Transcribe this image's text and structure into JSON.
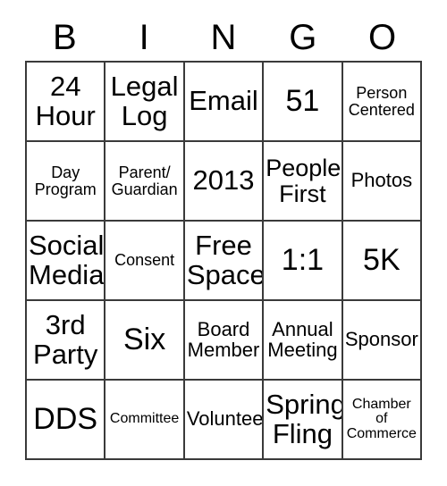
{
  "card": {
    "title_letters": [
      "B",
      "I",
      "N",
      "G",
      "O"
    ],
    "columns": 5,
    "rows": 5,
    "grid": [
      [
        {
          "text": "24\nHour",
          "size": "fs-xl"
        },
        {
          "text": "Legal\nLog",
          "size": "fs-xl"
        },
        {
          "text": "Email",
          "size": "fs-xl"
        },
        {
          "text": "51",
          "size": "fs-xxl"
        },
        {
          "text": "Person\nCentered",
          "size": "fs-s"
        }
      ],
      [
        {
          "text": "Day\nProgram",
          "size": "fs-s"
        },
        {
          "text": "Parent/\nGuardian",
          "size": "fs-s"
        },
        {
          "text": "2013",
          "size": "fs-xl"
        },
        {
          "text": "People\nFirst",
          "size": "fs-l"
        },
        {
          "text": "Photos",
          "size": "fs-m"
        }
      ],
      [
        {
          "text": "Social\nMedia",
          "size": "fs-xl"
        },
        {
          "text": "Consent",
          "size": "fs-s"
        },
        {
          "text": "Free\nSpace",
          "size": "fs-xl"
        },
        {
          "text": "1:1",
          "size": "fs-xxl"
        },
        {
          "text": "5K",
          "size": "fs-xxl"
        }
      ],
      [
        {
          "text": "3rd\nParty",
          "size": "fs-xl"
        },
        {
          "text": "Six",
          "size": "fs-xxl"
        },
        {
          "text": "Board\nMember",
          "size": "fs-m"
        },
        {
          "text": "Annual\nMeeting",
          "size": "fs-m"
        },
        {
          "text": "Sponsor",
          "size": "fs-m"
        }
      ],
      [
        {
          "text": "DDS",
          "size": "fs-xxl"
        },
        {
          "text": "Committee",
          "size": "fs-xs"
        },
        {
          "text": "Volunteer",
          "size": "fs-m"
        },
        {
          "text": "Spring\nFling",
          "size": "fs-xl"
        },
        {
          "text": "Chamber\nof\nCommerce",
          "size": "fs-xs"
        }
      ]
    ],
    "free_space_cell": {
      "row": 2,
      "col": 2,
      "label": "Free Space"
    },
    "colors": {
      "background": "#ffffff",
      "text": "#000000",
      "grid_line": "#3a3a3a"
    }
  }
}
